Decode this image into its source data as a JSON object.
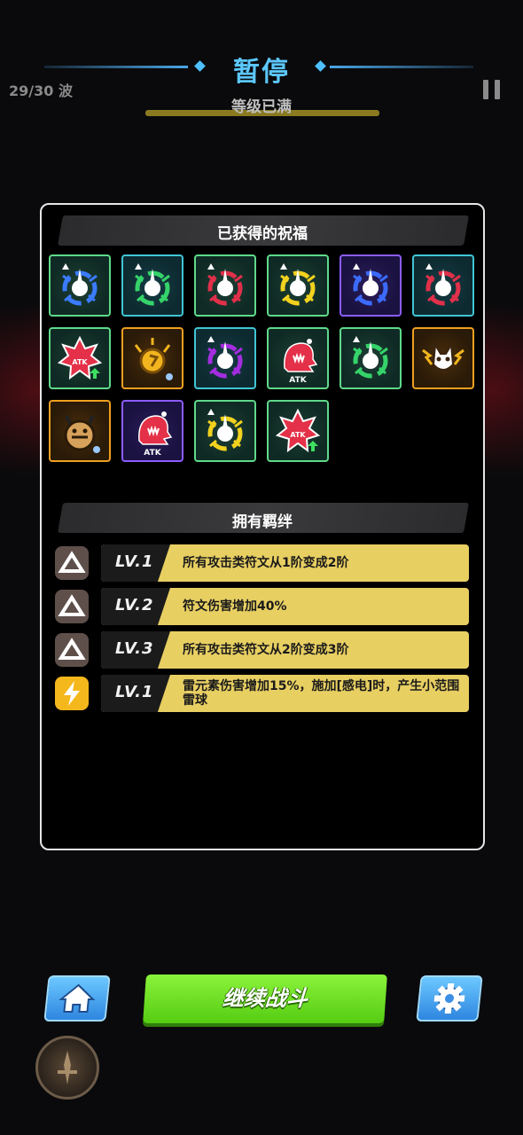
{
  "header": {
    "title": "暂停",
    "subtitle": "等级已满",
    "wave": "29/30 波"
  },
  "blessings": {
    "title": "已获得的祝福",
    "tiles": [
      {
        "frame": "green",
        "icon": "blue-rune-icon",
        "color": "#3b7bff",
        "triangle": true
      },
      {
        "frame": "teal",
        "icon": "green-rune-icon",
        "color": "#35d36a",
        "triangle": true
      },
      {
        "frame": "green",
        "icon": "red-rune-icon",
        "color": "#e0304a",
        "triangle": true
      },
      {
        "frame": "green",
        "icon": "yellow-rune-icon",
        "color": "#f2d21e",
        "triangle": true
      },
      {
        "frame": "purple",
        "icon": "blue-rune-icon",
        "color": "#3b6bff",
        "triangle": true
      },
      {
        "frame": "teal",
        "icon": "red-rune-icon",
        "color": "#e0304a",
        "triangle": true
      },
      {
        "frame": "green",
        "icon": "atk-up-badge-icon",
        "color": "#e43048",
        "triangle": false
      },
      {
        "frame": "orange",
        "icon": "thunder-orb-icon",
        "color": "#f2b51e",
        "triangle": false
      },
      {
        "frame": "teal",
        "icon": "purple-rune-icon",
        "color": "#a42de0",
        "triangle": true
      },
      {
        "frame": "green",
        "icon": "atk-monster-icon",
        "color": "#e43048",
        "triangle": false,
        "label": "ATK"
      },
      {
        "frame": "green",
        "icon": "green-rune-icon",
        "color": "#35d36a",
        "triangle": true
      },
      {
        "frame": "orange",
        "icon": "thunder-spirit-icon",
        "color": "#f2b51e",
        "triangle": false
      },
      {
        "frame": "orange",
        "icon": "horned-beast-icon",
        "color": "#d6a15a",
        "triangle": false
      },
      {
        "frame": "purple",
        "icon": "atk-monster-icon",
        "color": "#e43048",
        "triangle": false,
        "label": "ATK"
      },
      {
        "frame": "green",
        "icon": "yellow-rune-icon",
        "color": "#f2d21e",
        "triangle": true
      },
      {
        "frame": "green",
        "icon": "atk-up-badge-icon",
        "color": "#e43048",
        "triangle": false
      }
    ]
  },
  "bonds": {
    "title": "拥有羁绊",
    "items": [
      {
        "icon": "triangle-bond-icon",
        "level": "LV.1",
        "text": "所有攻击类符文从1阶变成2阶"
      },
      {
        "icon": "triangle-bond-icon",
        "level": "LV.2",
        "text": "符文伤害增加40%"
      },
      {
        "icon": "triangle-bond-icon",
        "level": "LV.3",
        "text": "所有攻击类符文从2阶变成3阶"
      },
      {
        "icon": "lightning-bond-icon",
        "level": "LV.1",
        "text": "雷元素伤害增加15%，施加[感电]时，产生小范围雷球"
      }
    ]
  },
  "footer": {
    "continue_label": "继续战斗",
    "home_icon": "home-icon",
    "settings_icon": "gear-icon"
  }
}
